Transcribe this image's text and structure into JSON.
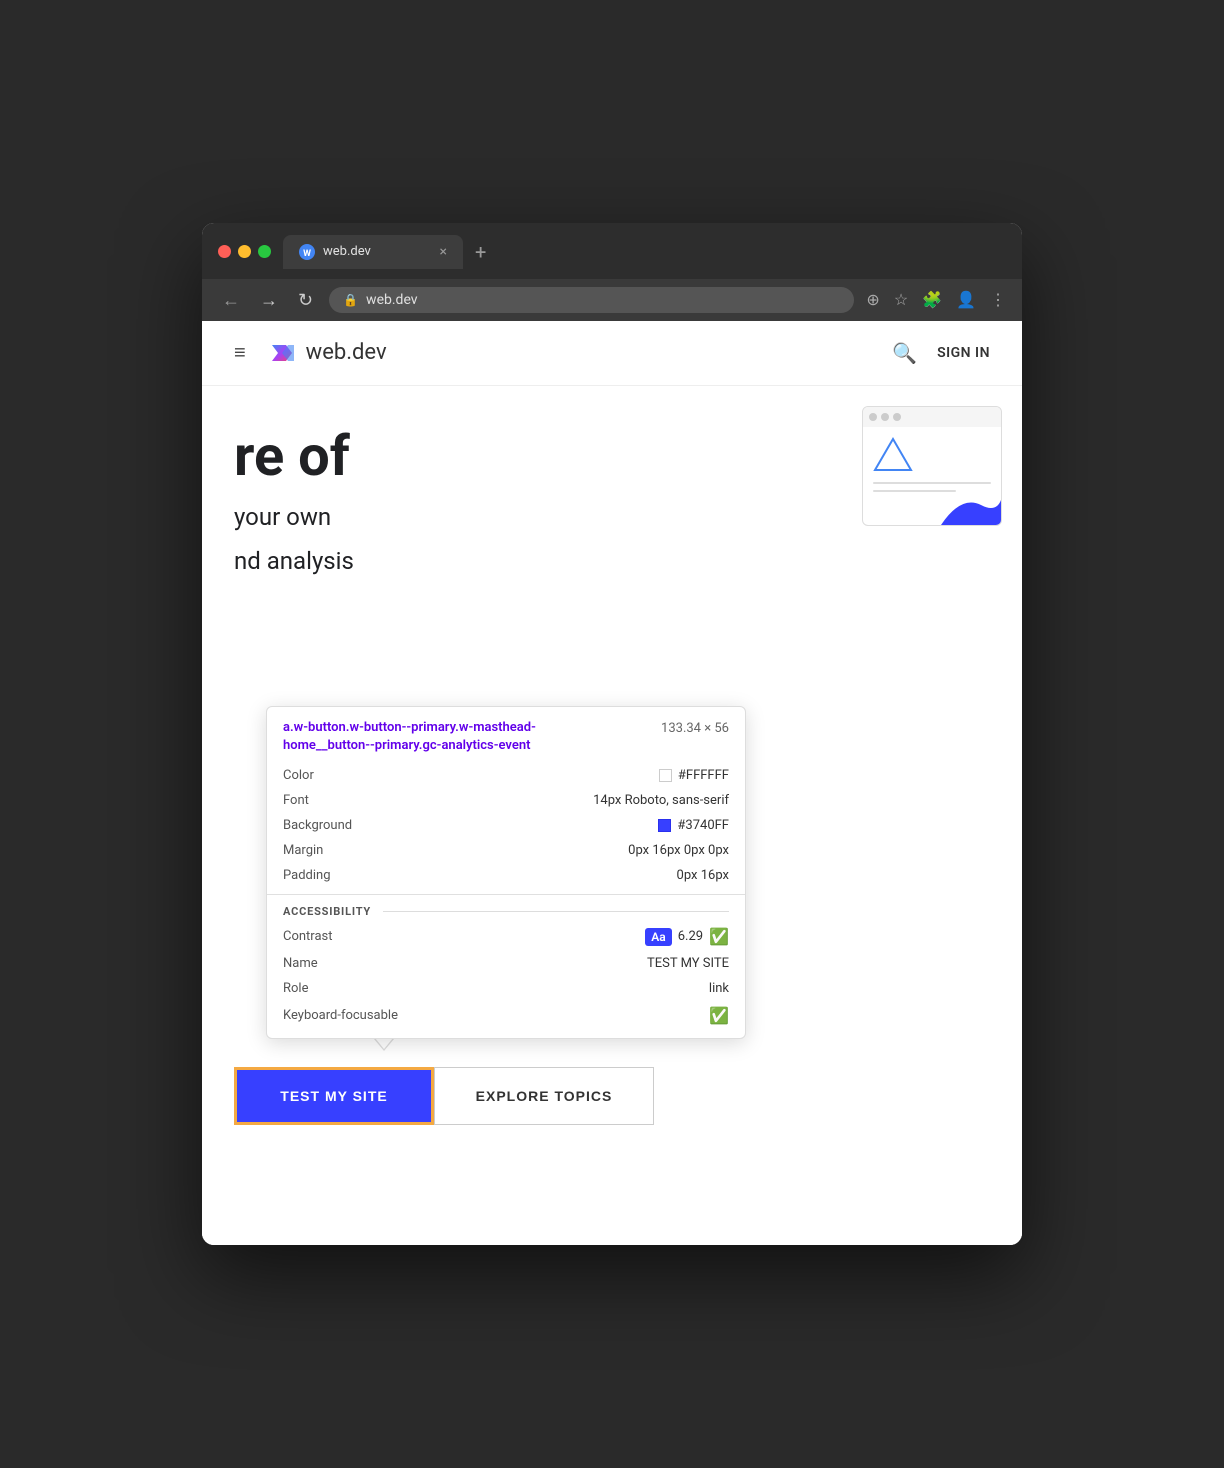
{
  "browser": {
    "tab": {
      "favicon_label": "W",
      "title": "web.dev",
      "close_label": "×"
    },
    "new_tab_label": "+",
    "address": "web.dev",
    "nav": {
      "back_label": "←",
      "forward_label": "→",
      "reload_label": "↻"
    },
    "toolbar_icons": [
      "⊕",
      "☆",
      "🧩",
      "👤",
      "⋮"
    ]
  },
  "site": {
    "header": {
      "menu_label": "≡",
      "site_name": "web.dev",
      "search_label": "🔍",
      "sign_in_label": "SIGN IN"
    },
    "hero": {
      "text_partial": "re of",
      "subtext_line1": "your own",
      "subtext_line2": "nd analysis"
    }
  },
  "inspector": {
    "selector": "a.w-button.w-button--primary.w-masthead-home__button--primary.gc-analytics-event",
    "dimensions": "133.34 × 56",
    "properties": {
      "color_label": "Color",
      "color_value": "#FFFFFF",
      "font_label": "Font",
      "font_value": "14px Roboto, sans-serif",
      "background_label": "Background",
      "background_value": "#3740FF",
      "margin_label": "Margin",
      "margin_value": "0px 16px 0px 0px",
      "padding_label": "Padding",
      "padding_value": "0px 16px"
    },
    "accessibility": {
      "section_label": "ACCESSIBILITY",
      "contrast_label": "Contrast",
      "contrast_value": "6.29",
      "contrast_badge": "Aa",
      "name_label": "Name",
      "name_value": "TEST MY SITE",
      "role_label": "Role",
      "role_value": "link",
      "keyboard_label": "Keyboard-focusable"
    }
  },
  "buttons": {
    "primary": {
      "label": "TEST MY SITE"
    },
    "secondary": {
      "label": "EXPLORE TOPICS"
    }
  }
}
